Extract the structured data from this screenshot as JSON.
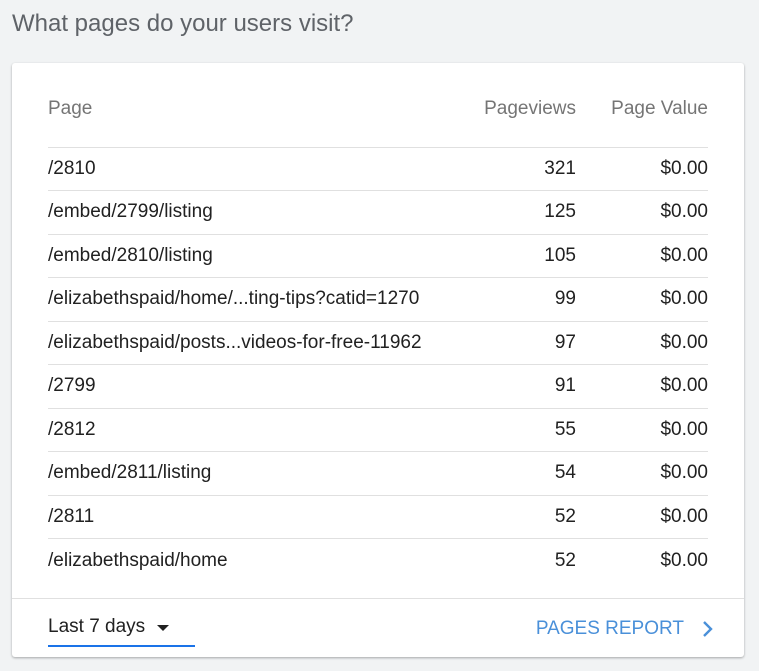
{
  "heading": "What pages do your users visit?",
  "table": {
    "columns": [
      "Page",
      "Pageviews",
      "Page Value"
    ],
    "rows": [
      {
        "page": "/2810",
        "pageviews": "321",
        "value": "$0.00"
      },
      {
        "page": "/embed/2799/listing",
        "pageviews": "125",
        "value": "$0.00"
      },
      {
        "page": "/embed/2810/listing",
        "pageviews": "105",
        "value": "$0.00"
      },
      {
        "page": "/elizabethspaid/home/...ting-tips?catid=1270",
        "pageviews": "99",
        "value": "$0.00"
      },
      {
        "page": "/elizabethspaid/posts...videos-for-free-11962",
        "pageviews": "97",
        "value": "$0.00"
      },
      {
        "page": "/2799",
        "pageviews": "91",
        "value": "$0.00"
      },
      {
        "page": "/2812",
        "pageviews": "55",
        "value": "$0.00"
      },
      {
        "page": "/embed/2811/listing",
        "pageviews": "54",
        "value": "$0.00"
      },
      {
        "page": "/2811",
        "pageviews": "52",
        "value": "$0.00"
      },
      {
        "page": "/elizabethspaid/home",
        "pageviews": "52",
        "value": "$0.00"
      }
    ]
  },
  "footer": {
    "date_range": "Last 7 days",
    "report_link": "PAGES REPORT",
    "accent_color": "#1a73e8",
    "link_color": "#4a90d9",
    "icons": {
      "dropdown": "caret-down-icon",
      "link": "chevron-right-icon"
    }
  }
}
